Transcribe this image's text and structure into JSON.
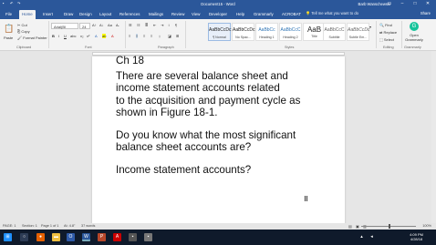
{
  "window": {
    "title": "Document15 - Word",
    "user": "Barb Wanschewski"
  },
  "tabs": [
    "File",
    "Home",
    "Insert",
    "Draw",
    "Design",
    "Layout",
    "References",
    "Mailings",
    "Review",
    "View",
    "Developer",
    "Help",
    "Grammarly",
    "ACROBAT"
  ],
  "active_tab": "Home",
  "tellme": {
    "placeholder": "Tell me what you want to do"
  },
  "share": "Share",
  "ribbon": {
    "clipboard": {
      "label": "Clipboard",
      "paste": "Paste",
      "cut": "Cut",
      "copy": "Copy",
      "format_painter": "Format Painter"
    },
    "font": {
      "label": "Font",
      "name": "Arial(Bl",
      "size": "24"
    },
    "paragraph": {
      "label": "Paragraph"
    },
    "styles": {
      "label": "Styles",
      "items": [
        {
          "sample": "AaBbCcDc",
          "name": "¶ Normal"
        },
        {
          "sample": "AaBbCcDc",
          "name": "No Spac..."
        },
        {
          "sample": "AaBbCc",
          "name": "Heading 1"
        },
        {
          "sample": "AaBbCcC",
          "name": "Heading 2"
        },
        {
          "sample": "AaB",
          "name": "Title"
        },
        {
          "sample": "AaBbCcC",
          "name": "Subtitle"
        },
        {
          "sample": "AaBbCcDc",
          "name": "Subtle Em..."
        }
      ]
    },
    "editing": {
      "label": "Editing",
      "find": "Find",
      "replace": "Replace",
      "select": "Select"
    },
    "grammarly": {
      "label": "Grammarly",
      "open": "Open Grammarly"
    }
  },
  "document": {
    "heading": "Ch 18",
    "p1": [
      "There are several balance sheet and",
      "income statement accounts related",
      "to the acquisition and payment cycle as",
      "shown in Figure 18-1."
    ],
    "p2": [
      "Do you know what the most significant",
      "balance sheet accounts are?"
    ],
    "p3": "Income statement accounts?"
  },
  "status": {
    "page": "PAGE: 1",
    "section": "Section: 1",
    "pageof": "Page 1 of 1",
    "at": "At: 4.8\"",
    "words": "37 words",
    "zoom": "100%"
  },
  "clock": {
    "time": "4:09 PM",
    "date": "4/28/18"
  }
}
